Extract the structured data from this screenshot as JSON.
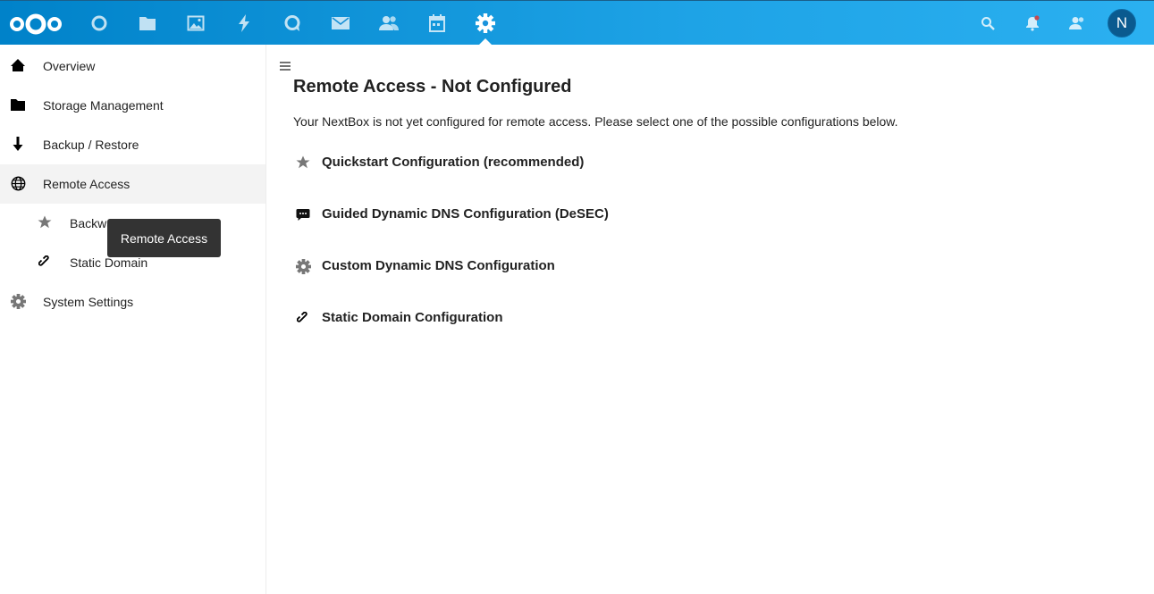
{
  "header": {
    "apps": [
      {
        "name": "dashboard",
        "icon": "circle-icon"
      },
      {
        "name": "files",
        "icon": "folder-icon"
      },
      {
        "name": "photos",
        "icon": "image-icon"
      },
      {
        "name": "activity",
        "icon": "lightning-icon"
      },
      {
        "name": "talk",
        "icon": "chat-bubble-icon"
      },
      {
        "name": "mail",
        "icon": "envelope-icon"
      },
      {
        "name": "contacts",
        "icon": "people-icon"
      },
      {
        "name": "calendar",
        "icon": "calendar-icon"
      },
      {
        "name": "settings",
        "icon": "gear-icon",
        "active": true
      }
    ],
    "avatar_initial": "N",
    "accent_color": "#0082c9"
  },
  "sidebar": {
    "items": [
      {
        "label": "Overview",
        "icon": "home-icon"
      },
      {
        "label": "Storage Management",
        "icon": "folder-icon"
      },
      {
        "label": "Backup / Restore",
        "icon": "arrow-down-icon"
      },
      {
        "label": "Remote Access",
        "icon": "globe-icon",
        "selected": true
      },
      {
        "label": "Backwards Proxy",
        "icon": "star-icon"
      },
      {
        "label": "Static Domain",
        "icon": "link-icon"
      },
      {
        "label": "System Settings",
        "icon": "gear-icon"
      }
    ],
    "tooltip": "Remote Access"
  },
  "main": {
    "title": "Remote Access - Not Configured",
    "intro": "Your NextBox is not yet configured for remote access. Please select one of the possible configurations below.",
    "options": [
      {
        "label": "Quickstart Configuration (recommended)",
        "icon": "star-icon"
      },
      {
        "label": "Guided Dynamic DNS Configuration (DeSEC)",
        "icon": "comment-icon"
      },
      {
        "label": "Custom Dynamic DNS Configuration",
        "icon": "gear-icon"
      },
      {
        "label": "Static Domain Configuration",
        "icon": "link-icon"
      }
    ]
  }
}
